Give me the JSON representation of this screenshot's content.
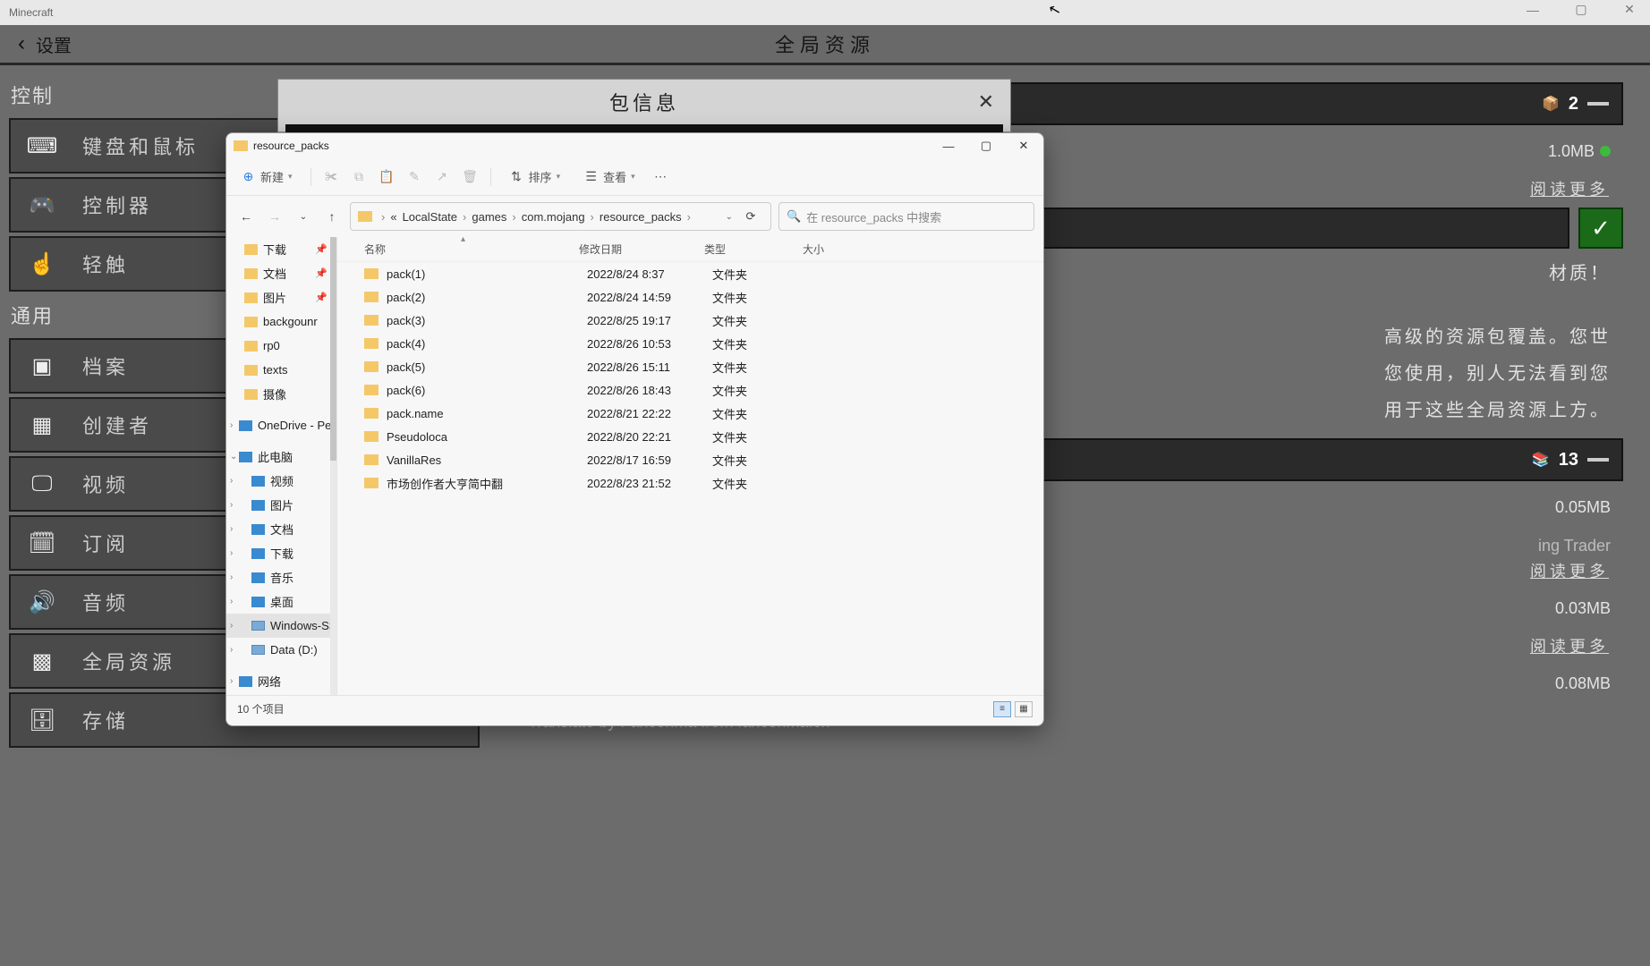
{
  "titlebar": {
    "app": "Minecraft"
  },
  "header": {
    "back": "‹",
    "settings": "设置",
    "center": "全局资源"
  },
  "mc": {
    "sections": {
      "control": "控制",
      "control_items": [
        "键盘和鼠标",
        "控制器",
        "轻触"
      ],
      "general": "通用",
      "general_items": [
        "档案",
        "创建者",
        "视频",
        "订阅",
        "音频",
        "全局资源",
        "存储"
      ]
    }
  },
  "right": {
    "size1": "1.0MB",
    "read_more": "阅读更多",
    "texture_hint": "材质！",
    "desc_lines": [
      "高级的资源包覆盖。您世",
      "您使用，别人无法看到您",
      "用于这些全局资源上方。"
    ],
    "badge2": "2",
    "badge13": "13",
    "size2": "0.05MB",
    "trader": "ing Trader",
    "size3": "0.03MB",
    "size4": "0.08MB",
    "translate": "Translate by Fanconma from fanconma.cn"
  },
  "modal": {
    "title": "包信息"
  },
  "explorer": {
    "title": "resource_packs",
    "toolbar": {
      "new": "新建",
      "sort": "排序",
      "view": "查看"
    },
    "breadcrumb": [
      "«",
      "LocalState",
      "games",
      "com.mojang",
      "resource_packs"
    ],
    "search_placeholder": "在 resource_packs 中搜索",
    "columns": {
      "name": "名称",
      "date": "修改日期",
      "type": "类型",
      "size": "大小"
    },
    "rows": [
      {
        "name": "pack(1)",
        "date": "2022/8/24 8:37",
        "type": "文件夹"
      },
      {
        "name": "pack(2)",
        "date": "2022/8/24 14:59",
        "type": "文件夹"
      },
      {
        "name": "pack(3)",
        "date": "2022/8/25 19:17",
        "type": "文件夹"
      },
      {
        "name": "pack(4)",
        "date": "2022/8/26 10:53",
        "type": "文件夹"
      },
      {
        "name": "pack(5)",
        "date": "2022/8/26 15:11",
        "type": "文件夹"
      },
      {
        "name": "pack(6)",
        "date": "2022/8/26 18:43",
        "type": "文件夹"
      },
      {
        "name": "pack.name",
        "date": "2022/8/21 22:22",
        "type": "文件夹"
      },
      {
        "name": "Pseudoloca",
        "date": "2022/8/20 22:21",
        "type": "文件夹"
      },
      {
        "name": "VanillaRes",
        "date": "2022/8/17 16:59",
        "type": "文件夹"
      },
      {
        "name": "市场创作者大亨简中翻",
        "date": "2022/8/23 21:52",
        "type": "文件夹"
      }
    ],
    "tree": {
      "quick": [
        "下载",
        "文档",
        "图片",
        "backgounr",
        "rp0",
        "texts",
        "摄像"
      ],
      "onedrive": "OneDrive - Pers",
      "thispc": "此电脑",
      "thispc_items": [
        "视频",
        "图片",
        "文档",
        "下载",
        "音乐",
        "桌面",
        "Windows-SSD",
        "Data (D:)"
      ],
      "network": "网络"
    },
    "status": "10 个项目"
  }
}
